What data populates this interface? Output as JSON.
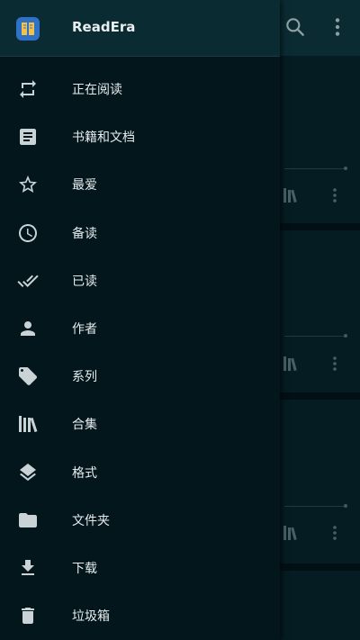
{
  "app": {
    "title": "ReadEra"
  },
  "colors": {
    "drawer_bg": "#03161c",
    "header_bg": "#0b2b33",
    "icon": "#c9d3d6",
    "text": "#e6ecee",
    "logo": "#2f71c5"
  },
  "topbar": {
    "icons": [
      "search-icon",
      "more-vert-icon"
    ]
  },
  "menu": {
    "items": [
      {
        "label": "正在阅读",
        "icon": "swap-arrows-icon"
      },
      {
        "label": "书籍和文档",
        "icon": "document-icon"
      },
      {
        "label": "最爱",
        "icon": "star-icon"
      },
      {
        "label": "备读",
        "icon": "clock-icon"
      },
      {
        "label": "已读",
        "icon": "double-check-icon"
      },
      {
        "label": "作者",
        "icon": "person-icon"
      },
      {
        "label": "系列",
        "icon": "tag-icon"
      },
      {
        "label": "合集",
        "icon": "books-icon"
      },
      {
        "label": "格式",
        "icon": "layers-icon"
      },
      {
        "label": "文件夹",
        "icon": "folder-icon"
      },
      {
        "label": "下载",
        "icon": "download-icon"
      },
      {
        "label": "垃圾箱",
        "icon": "trash-icon"
      }
    ]
  }
}
